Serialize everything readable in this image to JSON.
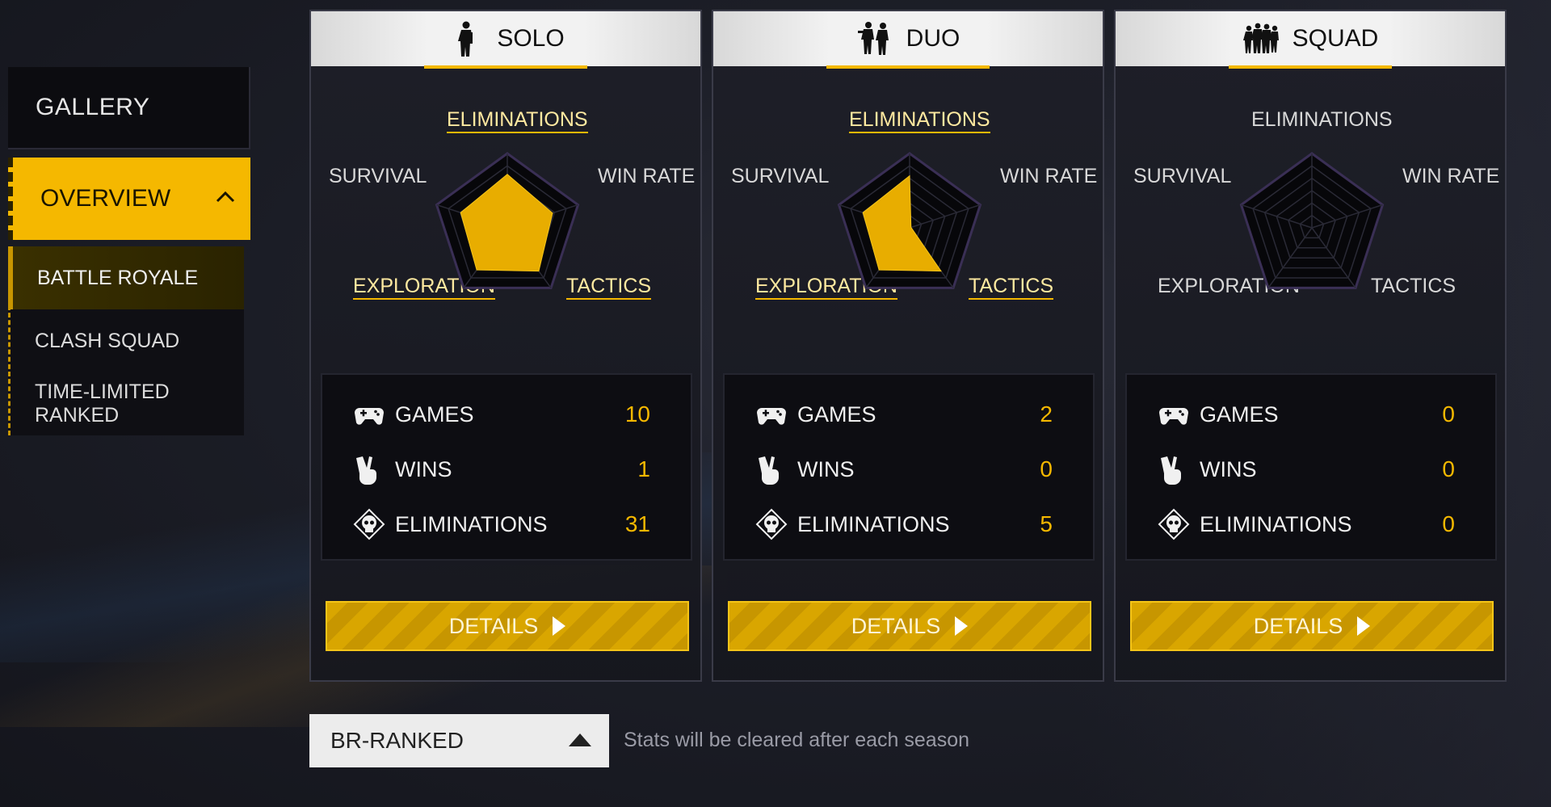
{
  "sidebar": {
    "gallery": "GALLERY",
    "overview": "OVERVIEW",
    "items": [
      {
        "label": "BATTLE ROYALE",
        "active": true
      },
      {
        "label": "CLASH SQUAD",
        "active": false
      },
      {
        "label": "TIME-LIMITED RANKED",
        "active": false
      }
    ]
  },
  "radar_labels": {
    "top": "ELIMINATIONS",
    "left": "SURVIVAL",
    "right": "WIN RATE",
    "bottom_left": "EXPLORATION",
    "bottom_right": "TACTICS"
  },
  "modes": [
    {
      "title": "SOLO",
      "icon": "solo-soldier-icon",
      "radar": {
        "eliminations": 0.72,
        "win_rate": 0.64,
        "tactics": 0.72,
        "exploration": 0.7,
        "survival": 0.66
      },
      "stats": {
        "games_label": "GAMES",
        "games": "10",
        "wins_label": "WINS",
        "wins": "1",
        "elims_label": "ELIMINATIONS",
        "elims": "31"
      },
      "details": "DETAILS"
    },
    {
      "title": "DUO",
      "icon": "duo-soldiers-icon",
      "radar": {
        "eliminations": 0.7,
        "win_rate": 0.02,
        "tactics": 0.72,
        "exploration": 0.7,
        "survival": 0.66
      },
      "stats": {
        "games_label": "GAMES",
        "games": "2",
        "wins_label": "WINS",
        "wins": "0",
        "elims_label": "ELIMINATIONS",
        "elims": "5"
      },
      "details": "DETAILS"
    },
    {
      "title": "SQUAD",
      "icon": "squad-soldiers-icon",
      "radar": {
        "eliminations": 0,
        "win_rate": 0,
        "tactics": 0,
        "exploration": 0,
        "survival": 0
      },
      "stats": {
        "games_label": "GAMES",
        "games": "0",
        "wins_label": "WINS",
        "wins": "0",
        "elims_label": "ELIMINATIONS",
        "elims": "0"
      },
      "details": "DETAILS"
    }
  ],
  "bottom": {
    "mode_select": "BR-RANKED",
    "season_note": "Stats will be cleared after each season"
  },
  "colors": {
    "accent": "#f5b800",
    "card_bg": "#1e1f28",
    "text": "#e8e8ea"
  }
}
